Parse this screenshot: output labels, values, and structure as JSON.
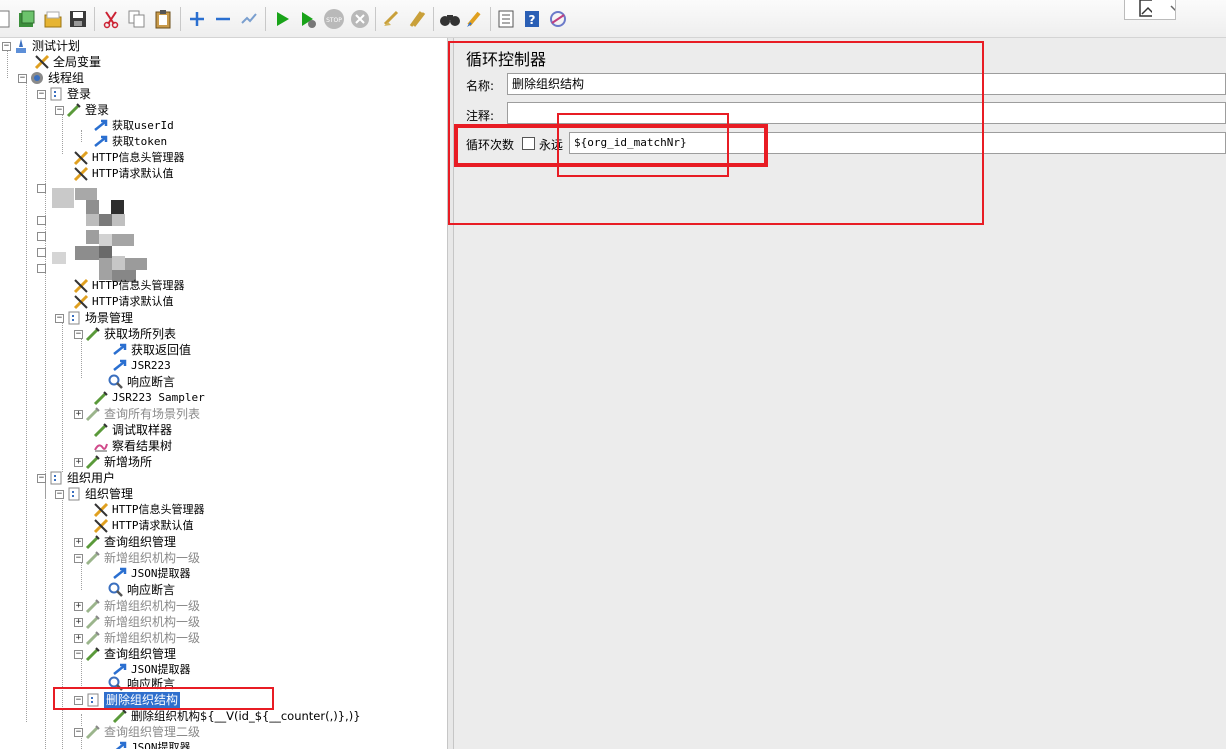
{
  "toolbar": {
    "buttons": [
      "new-icon",
      "templates-icon",
      "open-icon",
      "save-icon",
      "cut-icon",
      "copy-icon",
      "paste-icon",
      "expand-icon",
      "collapse-icon",
      "toggle-icon",
      "start-icon",
      "start-no-pause-icon",
      "stop-icon",
      "shutdown-icon",
      "clear-icon",
      "clear-all-icon",
      "search-icon",
      "reset-search-icon",
      "function-helper-icon",
      "help-icon",
      "remote-icon"
    ]
  },
  "tree": {
    "items": [
      {
        "label": "测试计划"
      },
      {
        "label": "全局变量"
      },
      {
        "label": "线程组"
      },
      {
        "label": "登录"
      },
      {
        "label": "登录"
      },
      {
        "label": "获取userId"
      },
      {
        "label": "获取token"
      },
      {
        "label": "HTTP信息头管理器"
      },
      {
        "label": "HTTP请求默认值"
      },
      {
        "label": "HTTP信息头管理器"
      },
      {
        "label": "HTTP请求默认值"
      },
      {
        "label": "场景管理"
      },
      {
        "label": "获取场所列表"
      },
      {
        "label": "获取返回值"
      },
      {
        "label": "JSR223"
      },
      {
        "label": "响应断言"
      },
      {
        "label": "JSR223 Sampler"
      },
      {
        "label": "查询所有场景列表"
      },
      {
        "label": "调试取样器"
      },
      {
        "label": "察看结果树"
      },
      {
        "label": "新增场所"
      },
      {
        "label": "组织用户"
      },
      {
        "label": "组织管理"
      },
      {
        "label": "HTTP信息头管理器"
      },
      {
        "label": "HTTP请求默认值"
      },
      {
        "label": "查询组织管理"
      },
      {
        "label": "新增组织机构一级"
      },
      {
        "label": "JSON提取器"
      },
      {
        "label": "响应断言"
      },
      {
        "label": "新增组织机构一级"
      },
      {
        "label": "新增组织机构一级"
      },
      {
        "label": "新增组织机构一级"
      },
      {
        "label": "查询组织管理"
      },
      {
        "label": "JSON提取器"
      },
      {
        "label": "响应断言"
      },
      {
        "label": "删除组织结构"
      },
      {
        "label": "删除组织机构${__V(id_${__counter(,)},)}"
      },
      {
        "label": "查询组织管理二级"
      },
      {
        "label": "JSON提取器"
      }
    ]
  },
  "panel": {
    "title": "循环控制器",
    "name_label": "名称:",
    "name_value": "删除组织结构",
    "comment_label": "注释:",
    "comment_value": "",
    "loop_label": "循环次数",
    "forever_label": "永远",
    "loop_value": "${org_id_matchNr}"
  }
}
